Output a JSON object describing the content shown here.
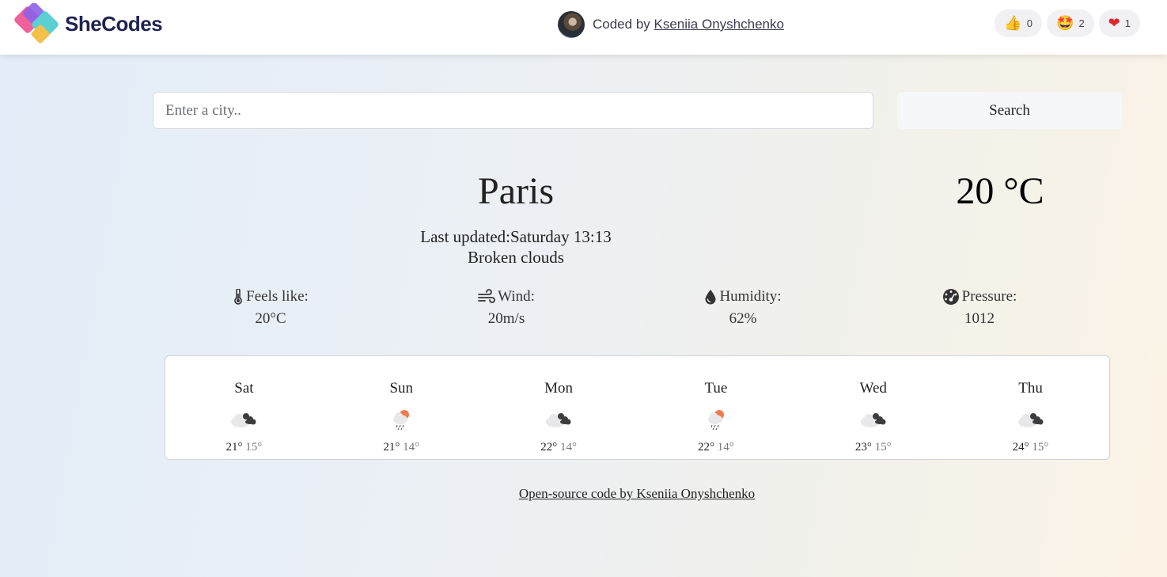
{
  "header": {
    "brand": "SheCodes",
    "coded_by_prefix": "Coded by ",
    "author": "Kseniia Onyshchenko",
    "reactions": [
      {
        "emoji": "👍",
        "count": "0",
        "icon": "thumbs-up-icon"
      },
      {
        "emoji": "🤩",
        "count": "2",
        "icon": "star-struck-icon"
      },
      {
        "emoji": "❤",
        "count": "1",
        "icon": "heart-icon"
      }
    ]
  },
  "search": {
    "placeholder": "Enter a city..",
    "button_label": "Search"
  },
  "current": {
    "city": "Paris",
    "temperature": "20 °C",
    "last_updated": "Last updated:Saturday 13:13",
    "description": "Broken clouds",
    "stats": [
      {
        "label": "Feels like:",
        "value": "20°C",
        "icon": "thermometer-icon"
      },
      {
        "label": "Wind:",
        "value": "20m/s",
        "icon": "wind-icon"
      },
      {
        "label": "Humidity:",
        "value": "62%",
        "icon": "droplet-icon"
      },
      {
        "label": "Pressure:",
        "value": "1012",
        "icon": "gauge-icon"
      }
    ]
  },
  "forecast": [
    {
      "day": "Sat",
      "max": "21°",
      "min": "15°",
      "icon": "broken-clouds-icon"
    },
    {
      "day": "Sun",
      "max": "21°",
      "min": "14°",
      "icon": "rain-sun-icon"
    },
    {
      "day": "Mon",
      "max": "22°",
      "min": "14°",
      "icon": "broken-clouds-icon"
    },
    {
      "day": "Tue",
      "max": "22°",
      "min": "14°",
      "icon": "rain-sun-icon"
    },
    {
      "day": "Wed",
      "max": "23°",
      "min": "15°",
      "icon": "broken-clouds-icon"
    },
    {
      "day": "Thu",
      "max": "24°",
      "min": "15°",
      "icon": "broken-clouds-icon"
    }
  ],
  "footer": {
    "link_text": "Open-source code by Kseniia Onyshchenko"
  },
  "colors": {
    "brand_text": "#1f2251",
    "sun": "#f07a4f",
    "cloud_light": "#e8e8ea",
    "cloud_dark": "#3c3c3c"
  }
}
